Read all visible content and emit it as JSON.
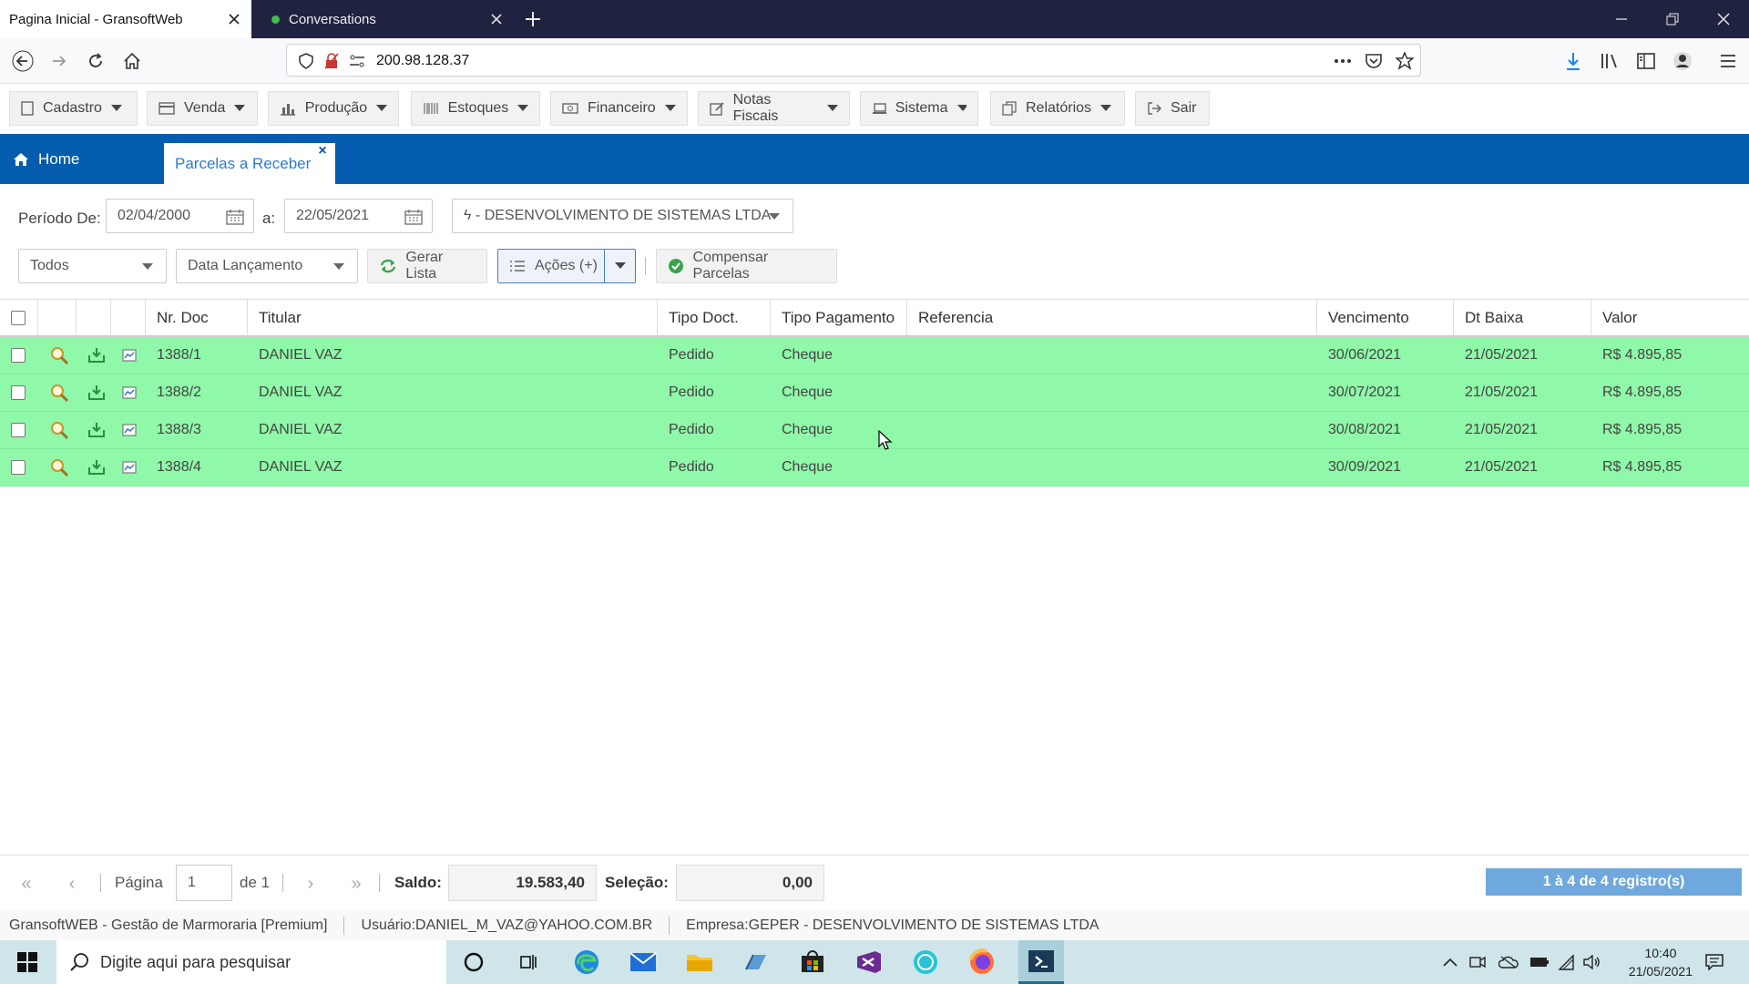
{
  "browser": {
    "tabs": [
      {
        "label": "Pagina Inicial - GransoftWeb",
        "active": true
      },
      {
        "label": "Conversations",
        "active": false
      }
    ],
    "url": "200.98.128.37"
  },
  "menu": [
    {
      "label": "Cadastro",
      "icon": "document-icon"
    },
    {
      "label": "Venda",
      "icon": "card-icon"
    },
    {
      "label": "Produção",
      "icon": "bar-chart-icon"
    },
    {
      "label": "Estoques",
      "icon": "barcode-icon"
    },
    {
      "label": "Financeiro",
      "icon": "money-icon"
    },
    {
      "label": "Notas Fiscais",
      "icon": "edit-icon"
    },
    {
      "label": "Sistema",
      "icon": "laptop-icon"
    },
    {
      "label": "Relatórios",
      "icon": "copy-icon"
    },
    {
      "label": "Sair",
      "icon": "sign-out-icon"
    }
  ],
  "page_tabs": {
    "home": "Home",
    "current": "Parcelas a Receber"
  },
  "filters": {
    "periodo_label": "Período De:",
    "date_from": "02/04/2000",
    "a_label": "a:",
    "date_to": "22/05/2021",
    "empresa": "ϟ - DESENVOLVIMENTO DE SISTEMAS LTDA",
    "status": "Todos",
    "date_type": "Data Lançamento",
    "gerar_lista": "Gerar Lista",
    "acoes": "Ações (+)",
    "compensar": "Compensar Parcelas"
  },
  "grid": {
    "columns": [
      "Nr. Doc",
      "Titular",
      "Tipo Doct.",
      "Tipo Pagamento",
      "Referencia",
      "Vencimento",
      "Dt Baixa",
      "Valor"
    ],
    "rows": [
      {
        "nr": "1388/1",
        "titular": "DANIEL VAZ",
        "tipo_doc": "Pedido",
        "tipo_pag": "Cheque",
        "ref": "",
        "venc": "30/06/2021",
        "baixa": "21/05/2021",
        "valor": "R$ 4.895,85"
      },
      {
        "nr": "1388/2",
        "titular": "DANIEL VAZ",
        "tipo_doc": "Pedido",
        "tipo_pag": "Cheque",
        "ref": "",
        "venc": "30/07/2021",
        "baixa": "21/05/2021",
        "valor": "R$ 4.895,85"
      },
      {
        "nr": "1388/3",
        "titular": "DANIEL VAZ",
        "tipo_doc": "Pedido",
        "tipo_pag": "Cheque",
        "ref": "",
        "venc": "30/08/2021",
        "baixa": "21/05/2021",
        "valor": "R$ 4.895,85"
      },
      {
        "nr": "1388/4",
        "titular": "DANIEL VAZ",
        "tipo_doc": "Pedido",
        "tipo_pag": "Cheque",
        "ref": "",
        "venc": "30/09/2021",
        "baixa": "21/05/2021",
        "valor": "R$ 4.895,85"
      }
    ],
    "row_color": "#8ff8a9"
  },
  "pager": {
    "pagina_label": "Página",
    "page": "1",
    "de_label": "de 1",
    "saldo_label": "Saldo:",
    "saldo": "19.583,40",
    "selecao_label": "Seleção:",
    "selecao": "0,00",
    "registros": "1 à 4 de 4 registro(s)"
  },
  "status": {
    "app": "GransoftWEB - Gestão de Marmoraria [Premium]",
    "usuario": "Usuário:DANIEL_M_VAZ@YAHOO.COM.BR",
    "empresa": "Empresa:GEPER - DESENVOLVIMENTO DE SISTEMAS LTDA"
  },
  "taskbar": {
    "search_placeholder": "Digite aqui para pesquisar",
    "time": "10:40",
    "date": "21/05/2021"
  },
  "colors": {
    "brand_blue": "#035cad",
    "accent_blue": "#2a7bd8",
    "row_green": "#8ff8a9"
  }
}
